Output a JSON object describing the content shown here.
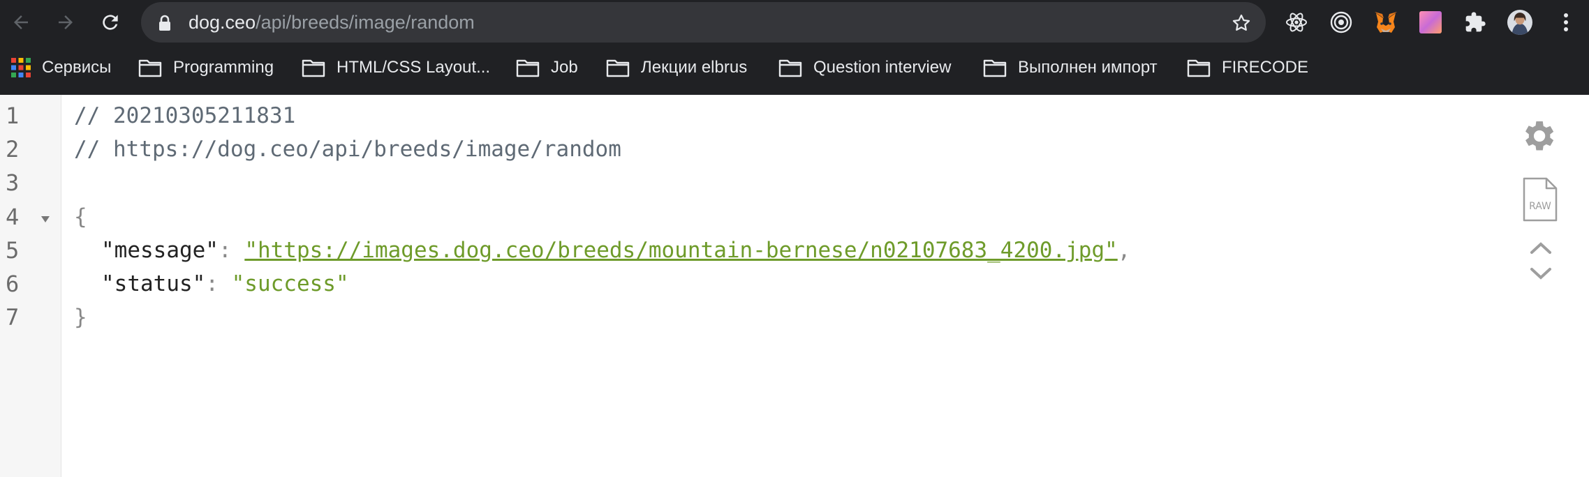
{
  "browser": {
    "url_host": "dog.ceo",
    "url_path": "/api/breeds/image/random"
  },
  "bookmarks": [
    {
      "label": "Сервисы",
      "icon": "apps-grid-icon"
    },
    {
      "label": "Programming",
      "icon": "folder-icon"
    },
    {
      "label": "HTML/CSS Layout...",
      "icon": "folder-icon"
    },
    {
      "label": "Job",
      "icon": "folder-icon"
    },
    {
      "label": "Лекции elbrus",
      "icon": "folder-icon"
    },
    {
      "label": "Question interview",
      "icon": "folder-icon"
    },
    {
      "label": "Выполнен импорт",
      "icon": "folder-icon"
    },
    {
      "label": "FIRECODE",
      "icon": "folder-icon"
    }
  ],
  "viewer": {
    "line_numbers": [
      "1",
      "2",
      "3",
      "4",
      "5",
      "6",
      "7"
    ],
    "comment_timestamp": "// 20210305211831",
    "comment_url": "// https://dog.ceo/api/breeds/image/random",
    "open_brace": "{",
    "close_brace": "}",
    "entries": [
      {
        "key": "\"message\"",
        "value": "\"https://images.dog.ceo/breeds/mountain-bernese/n02107683_4200.jpg\"",
        "trailing": ","
      },
      {
        "key": "\"status\"",
        "value": "\"success\"",
        "trailing": ""
      }
    ],
    "colon": ": ",
    "raw_label": "RAW"
  },
  "colors": {
    "toolbar_bg": "#202124",
    "string_green": "#6e9b2a",
    "gutter_bg": "#f6f6f6"
  }
}
